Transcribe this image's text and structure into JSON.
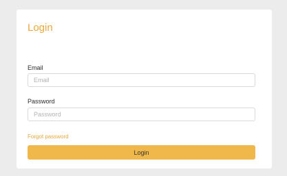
{
  "colors": {
    "accent": "#f0b84a",
    "accent_text": "#e8a83a",
    "background": "#ececec",
    "card": "#ffffff"
  },
  "login_form": {
    "title": "Login",
    "email": {
      "label": "Email",
      "placeholder": "Email",
      "value": ""
    },
    "password": {
      "label": "Password",
      "placeholder": "Password",
      "value": ""
    },
    "forgot_password_label": "Forgot password",
    "submit_label": "Login"
  }
}
